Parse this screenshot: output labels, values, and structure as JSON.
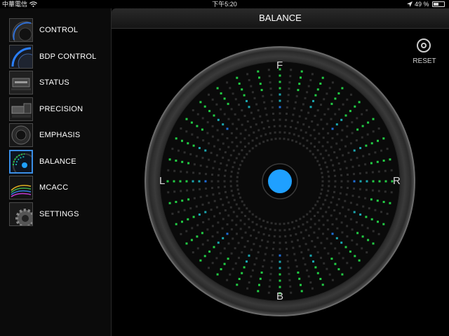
{
  "status_bar": {
    "carrier": "中華電信",
    "time": "下午5:20",
    "battery_text": "49 %",
    "battery_level": 0.49,
    "icons": [
      "wifi-icon",
      "location-arrow-icon",
      "battery-icon"
    ]
  },
  "sidebar": {
    "items": [
      {
        "label": "CONTROL",
        "icon": "control-thumb-icon",
        "active": false
      },
      {
        "label": "BDP CONTROL",
        "icon": "bdp-control-thumb-icon",
        "active": false
      },
      {
        "label": "STATUS",
        "icon": "status-thumb-icon",
        "active": false
      },
      {
        "label": "PRECISION",
        "icon": "precision-thumb-icon",
        "active": false
      },
      {
        "label": "EMPHASIS",
        "icon": "emphasis-thumb-icon",
        "active": false
      },
      {
        "label": "BALANCE",
        "icon": "balance-thumb-icon",
        "active": true
      },
      {
        "label": "MCACC",
        "icon": "mcacc-thumb-icon",
        "active": false
      },
      {
        "label": "SETTINGS",
        "icon": "settings-thumb-icon",
        "active": false
      }
    ]
  },
  "header": {
    "title": "BALANCE"
  },
  "reset": {
    "label": "RESET",
    "icon": "reset-target-icon"
  },
  "balance": {
    "labels": {
      "front": "F",
      "back": "B",
      "left": "L",
      "right": "R"
    },
    "knob_position": {
      "x": 0.0,
      "y": 0.0
    },
    "colors": {
      "knob": "#1fa0ff",
      "dot_green": "#22cc44",
      "dot_teal": "#1aa7b0",
      "dot_blue": "#1e6fd9",
      "dot_dim": "#2e2e2e"
    }
  }
}
